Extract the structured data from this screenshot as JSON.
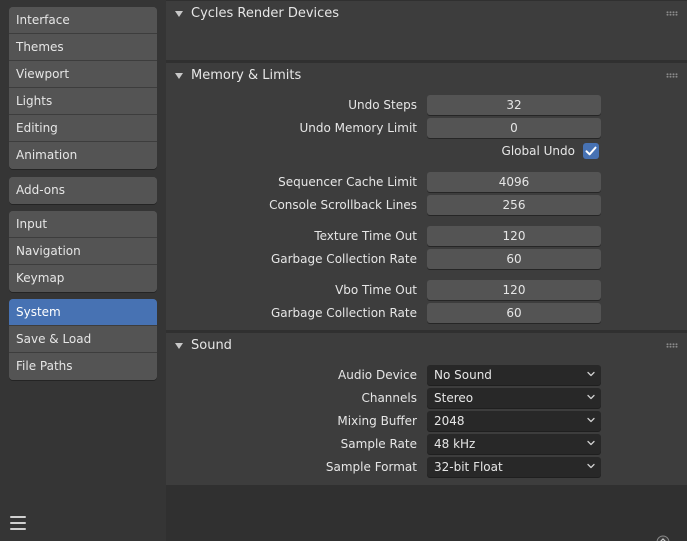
{
  "sidebar": {
    "groups": [
      [
        "Interface",
        "Themes",
        "Viewport",
        "Lights",
        "Editing",
        "Animation"
      ],
      [
        "Add-ons"
      ],
      [
        "Input",
        "Navigation",
        "Keymap"
      ],
      [
        "System",
        "Save & Load",
        "File Paths"
      ]
    ],
    "active": "System"
  },
  "panels": {
    "cycles": {
      "title": "Cycles Render Devices"
    },
    "memory": {
      "title": "Memory & Limits",
      "undo_steps": {
        "label": "Undo Steps",
        "value": "32"
      },
      "undo_memory_limit": {
        "label": "Undo Memory Limit",
        "value": "0"
      },
      "global_undo": {
        "label": "Global Undo",
        "checked": true
      },
      "sequencer_cache_limit": {
        "label": "Sequencer Cache Limit",
        "value": "4096"
      },
      "console_scrollback_lines": {
        "label": "Console Scrollback Lines",
        "value": "256"
      },
      "texture_time_out": {
        "label": "Texture Time Out",
        "value": "120"
      },
      "texture_gc_rate": {
        "label": "Garbage Collection Rate",
        "value": "60"
      },
      "vbo_time_out": {
        "label": "Vbo Time Out",
        "value": "120"
      },
      "vbo_gc_rate": {
        "label": "Garbage Collection Rate",
        "value": "60"
      }
    },
    "sound": {
      "title": "Sound",
      "audio_device": {
        "label": "Audio Device",
        "value": "No Sound"
      },
      "channels": {
        "label": "Channels",
        "value": "Stereo"
      },
      "mixing_buffer": {
        "label": "Mixing Buffer",
        "value": "2048"
      },
      "sample_rate": {
        "label": "Sample Rate",
        "value": "48 kHz"
      },
      "sample_format": {
        "label": "Sample Format",
        "value": "32-bit Float"
      }
    }
  },
  "colors": {
    "accent": "#4772b3",
    "background": "#303030",
    "panel": "#3d3d3d",
    "widget": "#545454",
    "dropdown": "#282828"
  },
  "icons": {
    "menu": "hamburger-menu-icon",
    "panel_collapse": "triangle-down-icon",
    "panel_drag": "drag-grip-icon",
    "dropdown": "chevron-down-icon",
    "checkbox": "checkmark-icon"
  }
}
